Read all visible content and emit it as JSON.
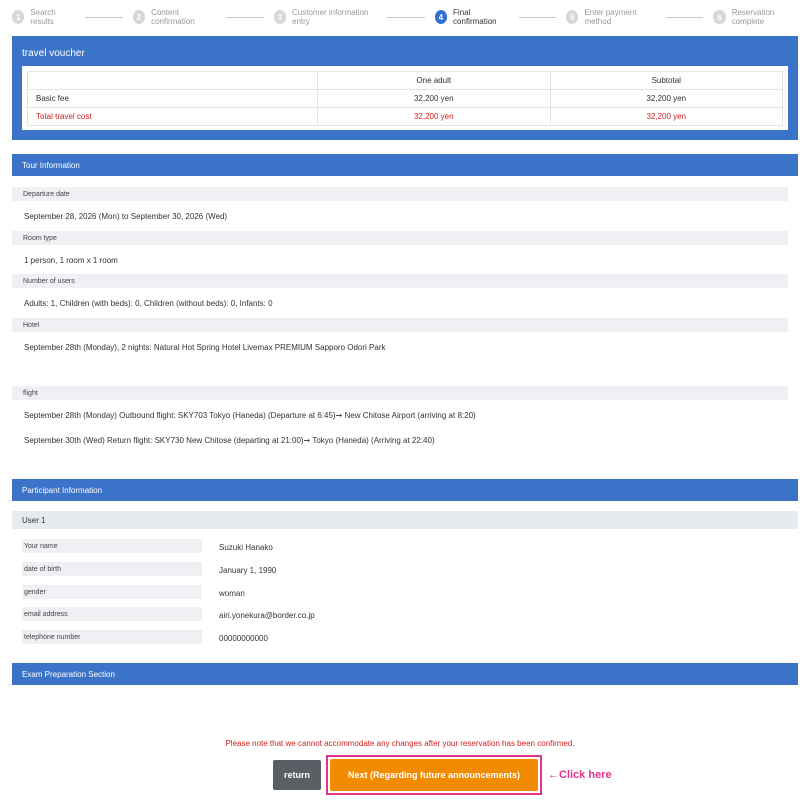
{
  "stepper": [
    {
      "num": "1",
      "label": "Search results",
      "active": false
    },
    {
      "num": "2",
      "label": "Content confirmation",
      "active": false
    },
    {
      "num": "3",
      "label": "Customer information entry",
      "active": false
    },
    {
      "num": "4",
      "label": "Final confirmation",
      "active": true
    },
    {
      "num": "5",
      "label": "Enter payment method",
      "active": false
    },
    {
      "num": "6",
      "label": "Reservation complete",
      "active": false
    }
  ],
  "voucher": {
    "title": "travel voucher",
    "headers": [
      "",
      "One adult",
      "Subtotal"
    ],
    "rows": [
      {
        "label": "Basic fee",
        "adult": "32,200 yen",
        "subtotal": "32,200 yen"
      },
      {
        "label": "Total travel cost",
        "adult": "32,200 yen",
        "subtotal": "32,200 yen"
      }
    ]
  },
  "tour": {
    "title": "Tour Information",
    "departure_label": "Departure date",
    "departure_value": "September 28, 2026 (Mon) to September 30, 2026 (Wed)",
    "room_label": "Room type",
    "room_value": "1 person, 1 room x 1 room",
    "users_label": "Number of users",
    "users_value": "Adults: 1, Children (with beds): 0, Children (without beds): 0, Infants: 0",
    "hotel_label": "Hotel",
    "hotel_value": "September 28th (Monday), 2 nights: Natural Hot Spring Hotel Livemax PREMIUM Sapporo Odori Park",
    "flight_label": "flight",
    "flight_out": "September 28th (Monday) Outbound flight: SKY703 Tokyo (Haneda) (Departure at 6:45)➞ New Chitose Airport (arriving at 8:20)",
    "flight_return": "September 30th (Wed) Return flight: SKY730 New Chitose (departing at 21:00)➞ Tokyo (Haneda) (Arriving at 22:40)"
  },
  "participant": {
    "title": "Participant Information",
    "user_title": "User 1",
    "fields": [
      {
        "label": "Your name",
        "value": "Suzuki Hanako"
      },
      {
        "label": "date of birth",
        "value": "January 1, 1990"
      },
      {
        "label": "gender",
        "value": "woman"
      },
      {
        "label": "email address",
        "value": "airi.yonekura@border.co.jp"
      },
      {
        "label": "telephone number",
        "value": "00000000000"
      }
    ]
  },
  "exam": {
    "title": "Exam Preparation Section"
  },
  "footer": {
    "note": "Please note that we cannot accommodate any changes after your reservation has been confirmed.",
    "return_label": "return",
    "next_label": "Next (Regarding future announcements)",
    "click_hint": "←Click here"
  },
  "colors": {
    "accent": "#3b73c8",
    "orange": "#f28b00",
    "pink": "#e2338d",
    "red": "#d12020"
  }
}
